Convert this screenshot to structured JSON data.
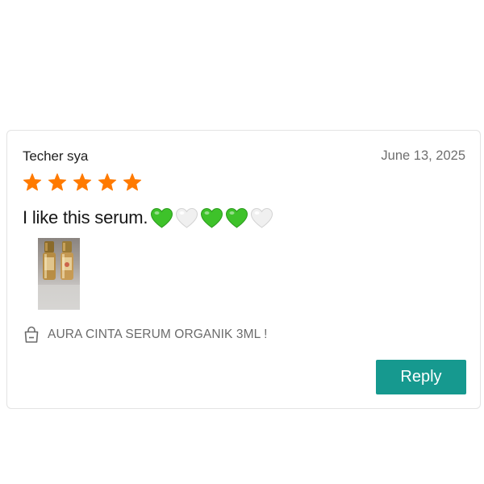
{
  "review": {
    "reviewer_name": "Techer sya",
    "date": "June 13, 2025",
    "rating": 5,
    "rating_max": 5,
    "text": "I like this serum.",
    "emoji_hearts": [
      "green",
      "white",
      "green",
      "green",
      "white"
    ],
    "photo_icon": "product-photo-thumbnail",
    "product": {
      "icon": "shopping-bag-icon",
      "name": "AURA CINTA SERUM ORGANIK 3ML !"
    },
    "reply_label": "Reply"
  },
  "colors": {
    "star": "#ff7a00",
    "accent": "#16998f",
    "heart_green": "#3ec22a",
    "heart_white": "#f0f0f0",
    "muted_text": "#6f6f6f"
  }
}
